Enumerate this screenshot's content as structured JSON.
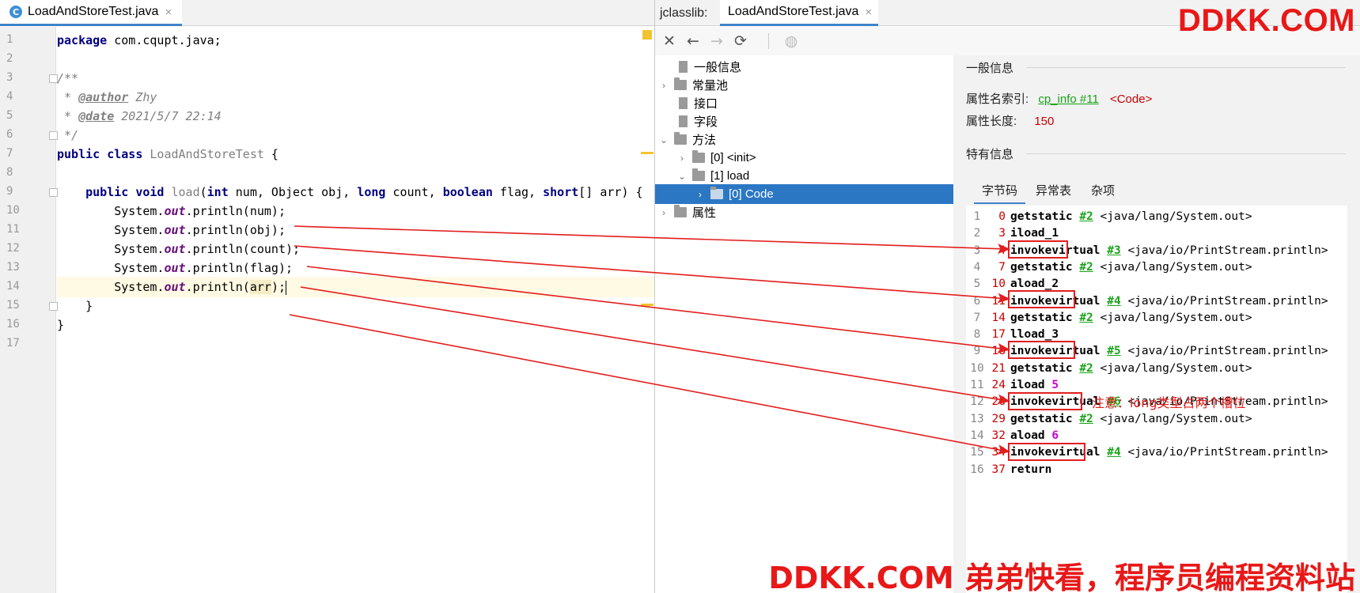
{
  "editor": {
    "tab_label": "LoadAndStoreTest.java",
    "tab_icon_letter": "C",
    "close_glyph": "×",
    "lines": [
      [
        {
          "t": "package",
          "c": "kw"
        },
        {
          "t": " com.cqupt.java;"
        }
      ],
      [],
      [
        {
          "t": "/**",
          "c": "cm"
        }
      ],
      [
        {
          "t": " * ",
          "c": "cm"
        },
        {
          "t": "@author",
          "c": "ctag"
        },
        {
          "t": " Zhy",
          "c": "cm"
        }
      ],
      [
        {
          "t": " * ",
          "c": "cm"
        },
        {
          "t": "@date",
          "c": "ctag"
        },
        {
          "t": " 2021/5/7 22:14",
          "c": "cm"
        }
      ],
      [
        {
          "t": " */",
          "c": "cm"
        }
      ],
      [
        {
          "t": "public class",
          "c": "kw"
        },
        {
          "t": " "
        },
        {
          "t": "LoadAndStoreTest",
          "c": "mth"
        },
        {
          "t": " {"
        }
      ],
      [],
      [
        {
          "t": "    "
        },
        {
          "t": "public void",
          "c": "kw"
        },
        {
          "t": " "
        },
        {
          "t": "load",
          "c": "mth"
        },
        {
          "t": "("
        },
        {
          "t": "int",
          "c": "kw"
        },
        {
          "t": " num, Object obj, "
        },
        {
          "t": "long",
          "c": "kw"
        },
        {
          "t": " count, "
        },
        {
          "t": "boolean",
          "c": "kw"
        },
        {
          "t": " flag, "
        },
        {
          "t": "short",
          "c": "kw"
        },
        {
          "t": "[] arr) {"
        }
      ],
      [
        {
          "t": "        System."
        },
        {
          "t": "out",
          "c": "stat"
        },
        {
          "t": ".println(num);"
        }
      ],
      [
        {
          "t": "        System."
        },
        {
          "t": "out",
          "c": "stat"
        },
        {
          "t": ".println(obj);"
        }
      ],
      [
        {
          "t": "        System."
        },
        {
          "t": "out",
          "c": "stat"
        },
        {
          "t": ".println(count);"
        }
      ],
      [
        {
          "t": "        System."
        },
        {
          "t": "out",
          "c": "stat"
        },
        {
          "t": ".println(flag);"
        }
      ],
      [
        {
          "t": "        System."
        },
        {
          "t": "out",
          "c": "stat"
        },
        {
          "t": ".println("
        },
        {
          "t": "arr",
          "c": "sel"
        },
        {
          "t": ");"
        },
        {
          "caret": true
        }
      ],
      [
        {
          "t": "    }"
        }
      ],
      [
        {
          "t": "}"
        }
      ],
      []
    ],
    "current_line": 14
  },
  "jclasslib": {
    "title": "jclasslib:",
    "tab_label": "LoadAndStoreTest.java",
    "toolbar": [
      {
        "name": "close-icon",
        "glyph": "✕",
        "disabled": false
      },
      {
        "name": "back-icon",
        "glyph": "←",
        "disabled": false
      },
      {
        "name": "forward-icon",
        "glyph": "→",
        "disabled": true
      },
      {
        "name": "refresh-icon",
        "glyph": "⟳",
        "disabled": false
      },
      {
        "name": "web-icon",
        "glyph": "◍",
        "disabled": true
      }
    ],
    "tree": [
      {
        "label": "一般信息",
        "level": 0,
        "arrow": "",
        "icon": "file"
      },
      {
        "label": "常量池",
        "level": 0,
        "arrow": "›",
        "icon": "folder"
      },
      {
        "label": "接口",
        "level": 0,
        "arrow": "",
        "icon": "file"
      },
      {
        "label": "字段",
        "level": 0,
        "arrow": "",
        "icon": "file"
      },
      {
        "label": "方法",
        "level": 0,
        "arrow": "⌄",
        "icon": "folder"
      },
      {
        "label": "[0] <init>",
        "level": 1,
        "arrow": "›",
        "icon": "folder"
      },
      {
        "label": "[1] load",
        "level": 1,
        "arrow": "⌄",
        "icon": "folder"
      },
      {
        "label": "[0] Code",
        "level": 2,
        "arrow": "›",
        "icon": "folder",
        "selected": true
      },
      {
        "label": "属性",
        "level": 0,
        "arrow": "›",
        "icon": "folder"
      }
    ],
    "general_title": "一般信息",
    "attr_name_label": "属性名索引:",
    "attr_name_link": "cp_info #11",
    "attr_name_value": "<Code>",
    "attr_len_label": "属性长度:",
    "attr_len_value": "150",
    "specific_title": "特有信息",
    "tabs": [
      "字节码",
      "异常表",
      "杂项"
    ],
    "bytecode": [
      {
        "i": "1",
        "off": "0",
        "op": "getstatic",
        "ref": "#2",
        "cmt": "<java/lang/System.out>"
      },
      {
        "i": "2",
        "off": "3",
        "op": "iload_1"
      },
      {
        "i": "3",
        "off": "4",
        "op": "invokevirtual",
        "ref": "#3",
        "cmt": "<java/io/PrintStream.println>"
      },
      {
        "i": "4",
        "off": "7",
        "op": "getstatic",
        "ref": "#2",
        "cmt": "<java/lang/System.out>"
      },
      {
        "i": "5",
        "off": "10",
        "op": "aload_2"
      },
      {
        "i": "6",
        "off": "11",
        "op": "invokevirtual",
        "ref": "#4",
        "cmt": "<java/io/PrintStream.println>"
      },
      {
        "i": "7",
        "off": "14",
        "op": "getstatic",
        "ref": "#2",
        "cmt": "<java/lang/System.out>"
      },
      {
        "i": "8",
        "off": "17",
        "op": "lload_3"
      },
      {
        "i": "9",
        "off": "18",
        "op": "invokevirtual",
        "ref": "#5",
        "cmt": "<java/io/PrintStream.println>"
      },
      {
        "i": "10",
        "off": "21",
        "op": "getstatic",
        "ref": "#2",
        "cmt": "<java/lang/System.out>"
      },
      {
        "i": "11",
        "off": "24",
        "op": "iload",
        "val": "5"
      },
      {
        "i": "12",
        "off": "26",
        "op": "invokevirtual",
        "ref": "#6",
        "cmt": "<java/io/PrintStream.println>"
      },
      {
        "i": "13",
        "off": "29",
        "op": "getstatic",
        "ref": "#2",
        "cmt": "<java/lang/System.out>"
      },
      {
        "i": "14",
        "off": "32",
        "op": "aload",
        "val": "6"
      },
      {
        "i": "15",
        "off": "34",
        "op": "invokevirtual",
        "ref": "#4",
        "cmt": "<java/io/PrintStream.println>"
      },
      {
        "i": "16",
        "off": "37",
        "op": "return"
      }
    ],
    "note": "注意：long类型占两个槽位"
  },
  "watermark_top": "DDKK.COM",
  "watermark_bottom": "DDKK.COM 弟弟快看，程序员编程资料站",
  "colors": {
    "accent": "#4083c9",
    "selection": "#2b77c4",
    "annotation": "#e31e1e"
  }
}
